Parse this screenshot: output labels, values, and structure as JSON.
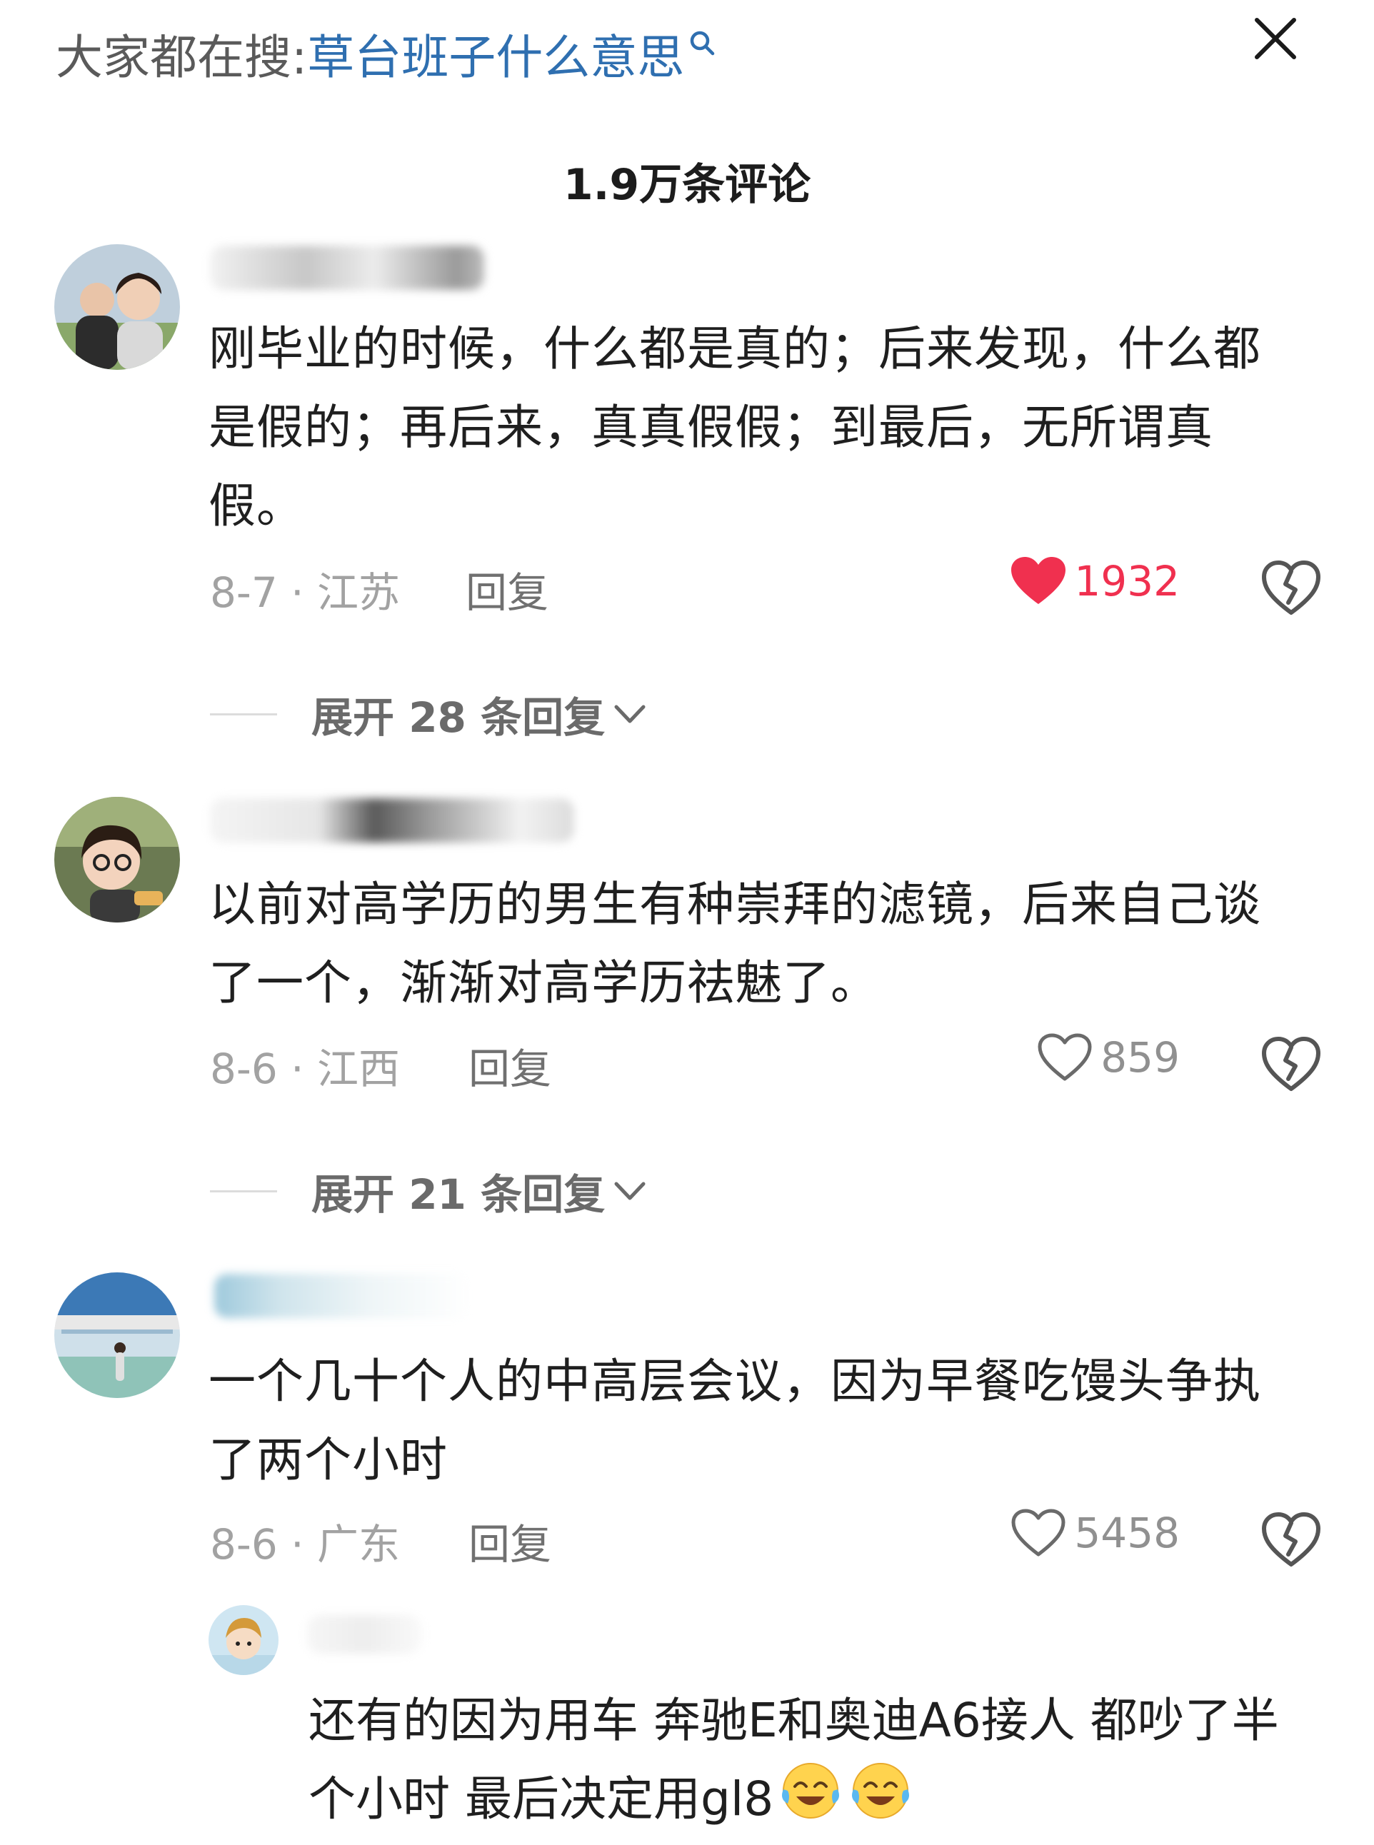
{
  "header": {
    "search_prefix": "大家都在搜:",
    "search_term": "草台班子什么意思",
    "search_icon": "search-icon",
    "close_icon": "close-icon"
  },
  "comment_count_title": "1.9万条评论",
  "colors": {
    "link": "#2f6fb0",
    "liked": "#f0304f",
    "meta": "#a2a2a2",
    "expand": "#6a6a6a"
  },
  "comments": [
    {
      "text": "刚毕业的时候，什么都是真的；后来发现，什么都是假的；再后来，真真假假；到最后，无所谓真假。",
      "date_location": "8-7 · 江苏",
      "reply_label": "回复",
      "likes": "1932",
      "liked": true,
      "expand_label": "展开 28 条回复"
    },
    {
      "text": "以前对高学历的男生有种崇拜的滤镜，后来自己谈了一个，渐渐对高学历祛魅了。",
      "date_location": "8-6 · 江西",
      "reply_label": "回复",
      "likes": "859",
      "liked": false,
      "expand_label": "展开 21 条回复"
    },
    {
      "text": "一个几十个人的中高层会议，因为早餐吃馒头争执了两个小时",
      "date_location": "8-6 · 广东",
      "reply_label": "回复",
      "likes": "5458",
      "liked": false
    }
  ],
  "sub_reply": {
    "text": "还有的因为用车 奔驰E和奥迪A6接人 都吵了半个小时  最后决定用gl8",
    "emoji_icons": [
      "crying-laughing-emoji-icon",
      "crying-laughing-emoji-icon"
    ]
  }
}
